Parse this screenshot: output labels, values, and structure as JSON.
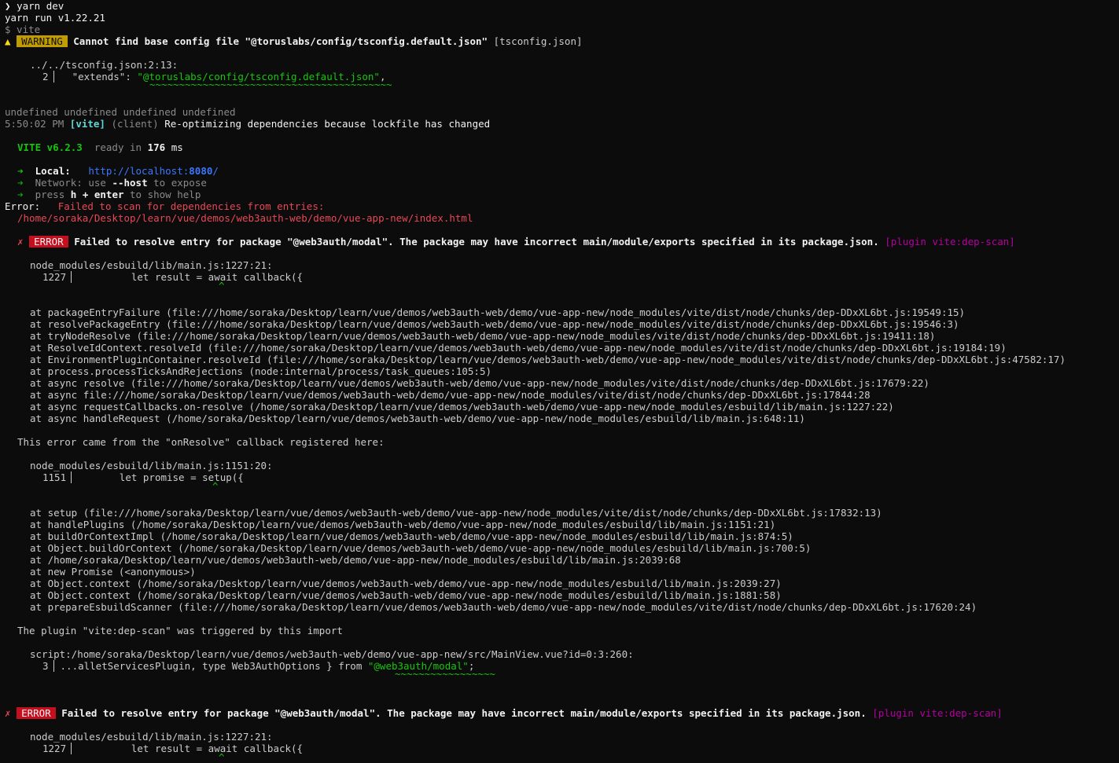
{
  "terminal": {
    "prompt_glyph": "❯",
    "command": "yarn dev",
    "yarn_version_line": "yarn run v1.22.21",
    "vite_cmd_line": "$ vite",
    "warning": {
      "glyph": "▲",
      "badge": "WARNING",
      "message": "Cannot find base config file \"@toruslabs/config/tsconfig.default.json\"",
      "tag": "[tsconfig.json]",
      "location": "../../tsconfig.json:2:13:",
      "line_no": "2",
      "code_key": "\"extends\": ",
      "code_value": "\"@toruslabs/config/tsconfig.default.json\"",
      "code_tail": ",",
      "squiggle": "~~~~~~~~~~~~~~~~~~~~~~~~~~~~~~~~~~~~~~~~~"
    },
    "undefined_line": "undefined undefined undefined undefined",
    "reopt": {
      "time": "5:50:02 PM",
      "vite_tag": "[vite]",
      "client_tag": "(client)",
      "message": "Re-optimizing dependencies because lockfile has changed"
    },
    "ready": {
      "vite_version": "VITE v6.2.3",
      "ready_text": "ready in",
      "ms_value": "176",
      "ms_unit": "ms"
    },
    "urls": {
      "arrow": "➜",
      "local_label": "Local:",
      "local_url_base": "http://localhost:",
      "local_url_port": "8080",
      "local_url_slash": "/",
      "network_label": "Network:",
      "network_use": "use",
      "network_flag": "--host",
      "network_tail": "to expose",
      "help_press": "press",
      "help_keys": "h + enter",
      "help_tail": "to show help"
    },
    "error_header": {
      "label": "Error:",
      "message": "Failed to scan for dependencies from entries:",
      "path": "/home/soraka/Desktop/learn/vue/demos/web3auth-web/demo/vue-app-new/index.html"
    },
    "error1": {
      "glyph": "✗",
      "badge": "ERROR",
      "message": "Failed to resolve entry for package \"@web3auth/modal\". The package may have incorrect main/module/exports specified in its package.json.",
      "plugin": "[plugin vite:dep-scan]",
      "location": "node_modules/esbuild/lib/main.js:1227:21:",
      "line_no": "1227",
      "code": "let result = await callback({",
      "caret": "^",
      "stack": [
        "at packageEntryFailure (file:///home/soraka/Desktop/learn/vue/demos/web3auth-web/demo/vue-app-new/node_modules/vite/dist/node/chunks/dep-DDxXL6bt.js:19549:15)",
        "at resolvePackageEntry (file:///home/soraka/Desktop/learn/vue/demos/web3auth-web/demo/vue-app-new/node_modules/vite/dist/node/chunks/dep-DDxXL6bt.js:19546:3)",
        "at tryNodeResolve (file:///home/soraka/Desktop/learn/vue/demos/web3auth-web/demo/vue-app-new/node_modules/vite/dist/node/chunks/dep-DDxXL6bt.js:19411:18)",
        "at ResolveIdContext.resolveId (file:///home/soraka/Desktop/learn/vue/demos/web3auth-web/demo/vue-app-new/node_modules/vite/dist/node/chunks/dep-DDxXL6bt.js:19184:19)",
        "at EnvironmentPluginContainer.resolveId (file:///home/soraka/Desktop/learn/vue/demos/web3auth-web/demo/vue-app-new/node_modules/vite/dist/node/chunks/dep-DDxXL6bt.js:47582:17)",
        "at process.processTicksAndRejections (node:internal/process/task_queues:105:5)",
        "at async resolve (file:///home/soraka/Desktop/learn/vue/demos/web3auth-web/demo/vue-app-new/node_modules/vite/dist/node/chunks/dep-DDxXL6bt.js:17679:22)",
        "at async file:///home/soraka/Desktop/learn/vue/demos/web3auth-web/demo/vue-app-new/node_modules/vite/dist/node/chunks/dep-DDxXL6bt.js:17844:28",
        "at async requestCallbacks.on-resolve (/home/soraka/Desktop/learn/vue/demos/web3auth-web/demo/vue-app-new/node_modules/esbuild/lib/main.js:1227:22)",
        "at async handleRequest (/home/soraka/Desktop/learn/vue/demos/web3auth-web/demo/vue-app-new/node_modules/esbuild/lib/main.js:648:11)"
      ],
      "origin_note": "This error came from the \"onResolve\" callback registered here:",
      "origin_location": "node_modules/esbuild/lib/main.js:1151:20:",
      "origin_line_no": "1151",
      "origin_code": "let promise = setup({",
      "origin_caret": "^",
      "origin_stack": [
        "at setup (file:///home/soraka/Desktop/learn/vue/demos/web3auth-web/demo/vue-app-new/node_modules/vite/dist/node/chunks/dep-DDxXL6bt.js:17832:13)",
        "at handlePlugins (/home/soraka/Desktop/learn/vue/demos/web3auth-web/demo/vue-app-new/node_modules/esbuild/lib/main.js:1151:21)",
        "at buildOrContextImpl (/home/soraka/Desktop/learn/vue/demos/web3auth-web/demo/vue-app-new/node_modules/esbuild/lib/main.js:874:5)",
        "at Object.buildOrContext (/home/soraka/Desktop/learn/vue/demos/web3auth-web/demo/vue-app-new/node_modules/esbuild/lib/main.js:700:5)",
        "at /home/soraka/Desktop/learn/vue/demos/web3auth-web/demo/vue-app-new/node_modules/esbuild/lib/main.js:2039:68",
        "at new Promise (<anonymous>)",
        "at Object.context (/home/soraka/Desktop/learn/vue/demos/web3auth-web/demo/vue-app-new/node_modules/esbuild/lib/main.js:2039:27)",
        "at Object.context (/home/soraka/Desktop/learn/vue/demos/web3auth-web/demo/vue-app-new/node_modules/esbuild/lib/main.js:1881:58)",
        "at prepareEsbuildScanner (file:///home/soraka/Desktop/learn/vue/demos/web3auth-web/demo/vue-app-new/node_modules/vite/dist/node/chunks/dep-DDxXL6bt.js:17620:24)"
      ],
      "trigger_note": "The plugin \"vite:dep-scan\" was triggered by this import",
      "trigger_location": "script:/home/soraka/Desktop/learn/vue/demos/web3auth-web/demo/vue-app-new/src/MainView.vue?id=0:3:260:",
      "trigger_line_no": "3",
      "trigger_code_pre": "...alletServicesPlugin, type Web3AuthOptions } from ",
      "trigger_code_str": "\"@web3auth/modal\"",
      "trigger_code_tail": ";",
      "trigger_squiggle": "~~~~~~~~~~~~~~~~~"
    },
    "error2": {
      "glyph": "✗",
      "badge": "ERROR",
      "message": "Failed to resolve entry for package \"@web3auth/modal\". The package may have incorrect main/module/exports specified in its package.json.",
      "plugin": "[plugin vite:dep-scan]",
      "location": "node_modules/esbuild/lib/main.js:1227:21:",
      "line_no": "1227",
      "code": "let result = await callback({",
      "caret": "^"
    }
  }
}
